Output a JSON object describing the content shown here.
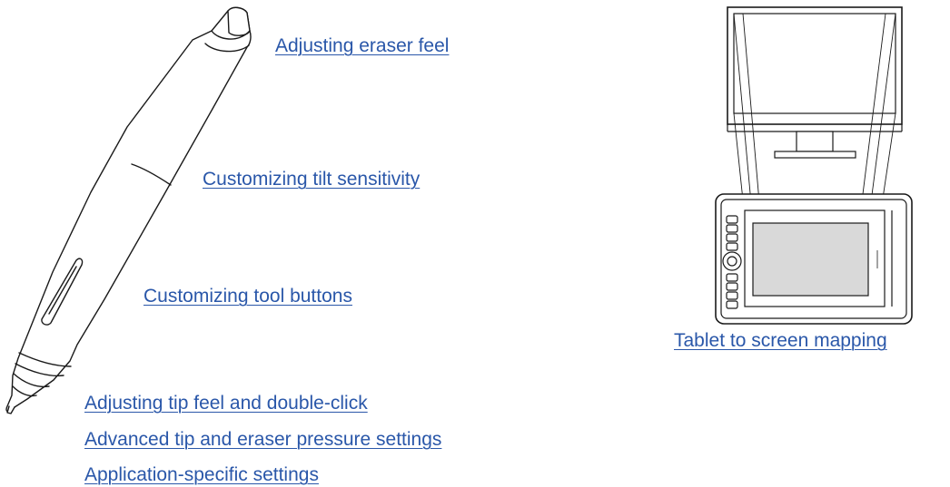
{
  "links": {
    "eraser_feel": "Adjusting eraser feel",
    "tilt_sensitivity": "Customizing tilt sensitivity",
    "tool_buttons": "Customizing tool buttons",
    "tip_feel": "Adjusting tip feel and double-click",
    "advanced_pressure": "Advanced tip and eraser pressure settings",
    "app_specific": "Application-specific settings",
    "tablet_mapping": "Tablet to screen mapping"
  },
  "colors": {
    "link": "#2a57a9",
    "line_art": "#1a1a1a",
    "active_area": "#d9d9d9"
  },
  "icons": [
    "pen-illustration",
    "monitor-illustration",
    "tablet-illustration"
  ]
}
